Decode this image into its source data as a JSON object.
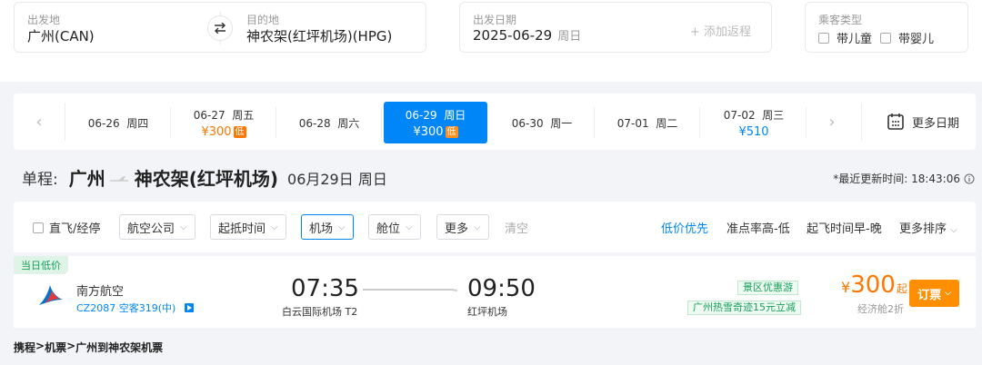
{
  "search": {
    "depart_label": "出发地",
    "depart_value": "广州(CAN)",
    "dest_label": "目的地",
    "dest_value": "神农架(红坪机场)(HPG)",
    "date_label": "出发日期",
    "date_value": "2025-06-29",
    "date_weekday": "周日",
    "add_return": "+ 添加返程",
    "passenger_label": "乘客类型",
    "passenger_options": [
      "带儿童",
      "带婴儿"
    ]
  },
  "date_strip": {
    "days": [
      {
        "date": "06-26",
        "weekday": "周四",
        "price": "",
        "low": false
      },
      {
        "date": "06-27",
        "weekday": "周五",
        "price": "¥300",
        "low": true
      },
      {
        "date": "06-28",
        "weekday": "周六",
        "price": "",
        "low": false
      },
      {
        "date": "06-29",
        "weekday": "周日",
        "price": "¥300",
        "low": true
      },
      {
        "date": "06-30",
        "weekday": "周一",
        "price": "",
        "low": false
      },
      {
        "date": "07-01",
        "weekday": "周二",
        "price": "",
        "low": false
      },
      {
        "date": "07-02",
        "weekday": "周三",
        "price": "¥510",
        "low": false
      }
    ],
    "low_tag": "低",
    "more_dates": "更多日期"
  },
  "heading": {
    "trip_type": "单程:",
    "from_city": "广州",
    "to_city": "神农架(红坪机场)",
    "date": "06月29日 周日",
    "updated": "*最近更新时间: 18:43:06"
  },
  "filters": {
    "direct": "直飞/经停",
    "dropdowns": [
      "航空公司",
      "起抵时间",
      "机场",
      "舱位",
      "更多"
    ],
    "clear": "清空",
    "sorts": [
      "低价优先",
      "准点率高-低",
      "起飞时间早-晚",
      "更多排序"
    ]
  },
  "flight": {
    "tag": "当日低价",
    "airline": "南方航空",
    "flight_no": "CZ2087 空客319(中)",
    "dep_time": "07:35",
    "dep_airport": "白云国际机场 T2",
    "arr_time": "09:50",
    "arr_airport": "红坪机场",
    "promo1": "景区优惠游",
    "promo2": "广州热雪奇迹15元立减",
    "price_symbol": "¥",
    "price": "300",
    "price_suffix": "起",
    "cabin": "经济舱2折",
    "book": "订票"
  },
  "breadcrumb": [
    "携程",
    "机票",
    "广州到神农架机票"
  ],
  "colors": {
    "brand_blue": "#0086f6",
    "price_orange": "#ff7700",
    "book_orange": "#ff8f00",
    "promo_green": "#15a05a"
  }
}
